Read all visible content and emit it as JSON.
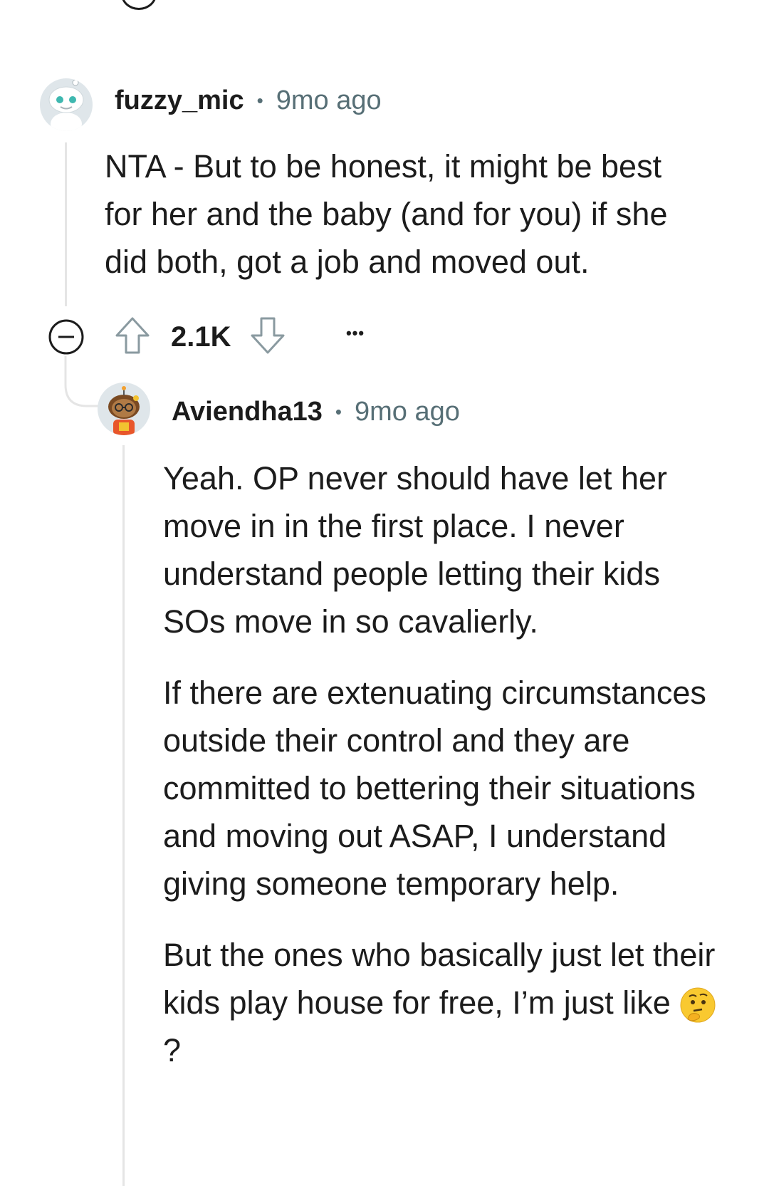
{
  "comments": [
    {
      "username": "fuzzy_mic",
      "separator": "•",
      "age": "9mo ago",
      "body": [
        "NTA - But to be honest, it might be best for her and the baby (and for you) if she did both, got a job and moved out."
      ],
      "score": "2.1K",
      "more_label": "•••"
    },
    {
      "username": "Aviendha13",
      "separator": "•",
      "age": "9mo ago",
      "body": [
        "Yeah. OP never should have let her move in in the first place. I never understand people letting their kids SOs move in so cavalierly.",
        "If there are extenuating circumstances outside their control and they are committed to bettering their situations and moving out ASAP, I understand giving someone temporary help.",
        "But the ones who basically just let their kids play house for free, I’m just like"
      ],
      "emoji_suffix": "?",
      "emoji_name": "thinking-face-emoji"
    }
  ],
  "colors": {
    "text": "#1c1c1c",
    "meta": "#576f76",
    "thread_line": "#e5e5e5",
    "avatar_bg": "#dfe6ea"
  }
}
